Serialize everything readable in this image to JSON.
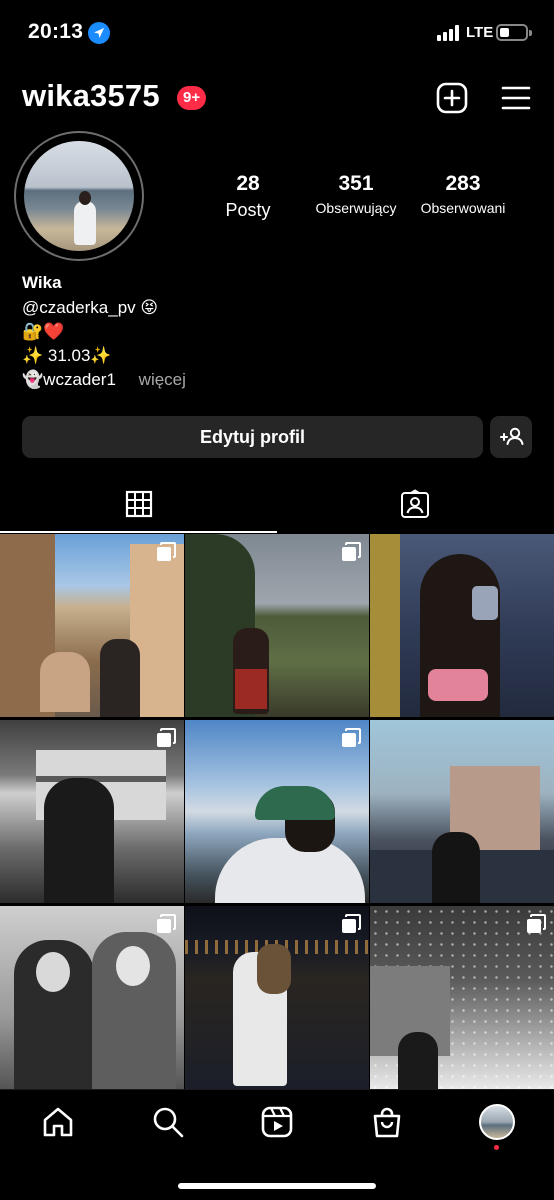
{
  "status": {
    "time": "20:13",
    "network": "LTE",
    "battery_level": 0.3
  },
  "header": {
    "username": "wika3575",
    "notification_badge": "9+",
    "icons": [
      "plus-square-icon",
      "hamburger-menu-icon"
    ]
  },
  "stats": [
    {
      "value": "28",
      "label": "Posty"
    },
    {
      "value": "351",
      "label": "Obserwujący"
    },
    {
      "value": "283",
      "label": "Obserwowani"
    }
  ],
  "bio": {
    "name": "Wika",
    "line1": "@czaderka_pv 😝",
    "line2": "🔐❤️",
    "line3": "✨ 31.03✨",
    "line4_main": "👻wczader1",
    "line4_more": "więcej"
  },
  "actions": {
    "edit_profile": "Edytuj profil"
  },
  "tabs": [
    {
      "icon": "grid-icon",
      "active": true
    },
    {
      "icon": "tagged-person-icon",
      "active": false
    }
  ],
  "posts": [
    {
      "id": 1,
      "multi": true,
      "palette": "city-street-couple"
    },
    {
      "id": 2,
      "multi": true,
      "palette": "field-path-girl"
    },
    {
      "id": 3,
      "multi": false,
      "palette": "mirror-selfie-pink"
    },
    {
      "id": 4,
      "multi": true,
      "palette": "bw-building"
    },
    {
      "id": 5,
      "multi": true,
      "palette": "lake-cap"
    },
    {
      "id": 6,
      "multi": false,
      "palette": "dusk-street"
    },
    {
      "id": 7,
      "multi": true,
      "palette": "bw-mirror-two"
    },
    {
      "id": 8,
      "multi": true,
      "palette": "night-lights-girl"
    },
    {
      "id": 9,
      "multi": true,
      "palette": "snow-night"
    }
  ],
  "nav": [
    "home-icon",
    "search-icon",
    "reels-icon",
    "shop-bag-icon",
    "profile-avatar"
  ],
  "colors": {
    "background": "#000000",
    "button": "#262626",
    "badge": "#ff2c47",
    "muted": "#a8a8a8",
    "location": "#1a8cff"
  }
}
